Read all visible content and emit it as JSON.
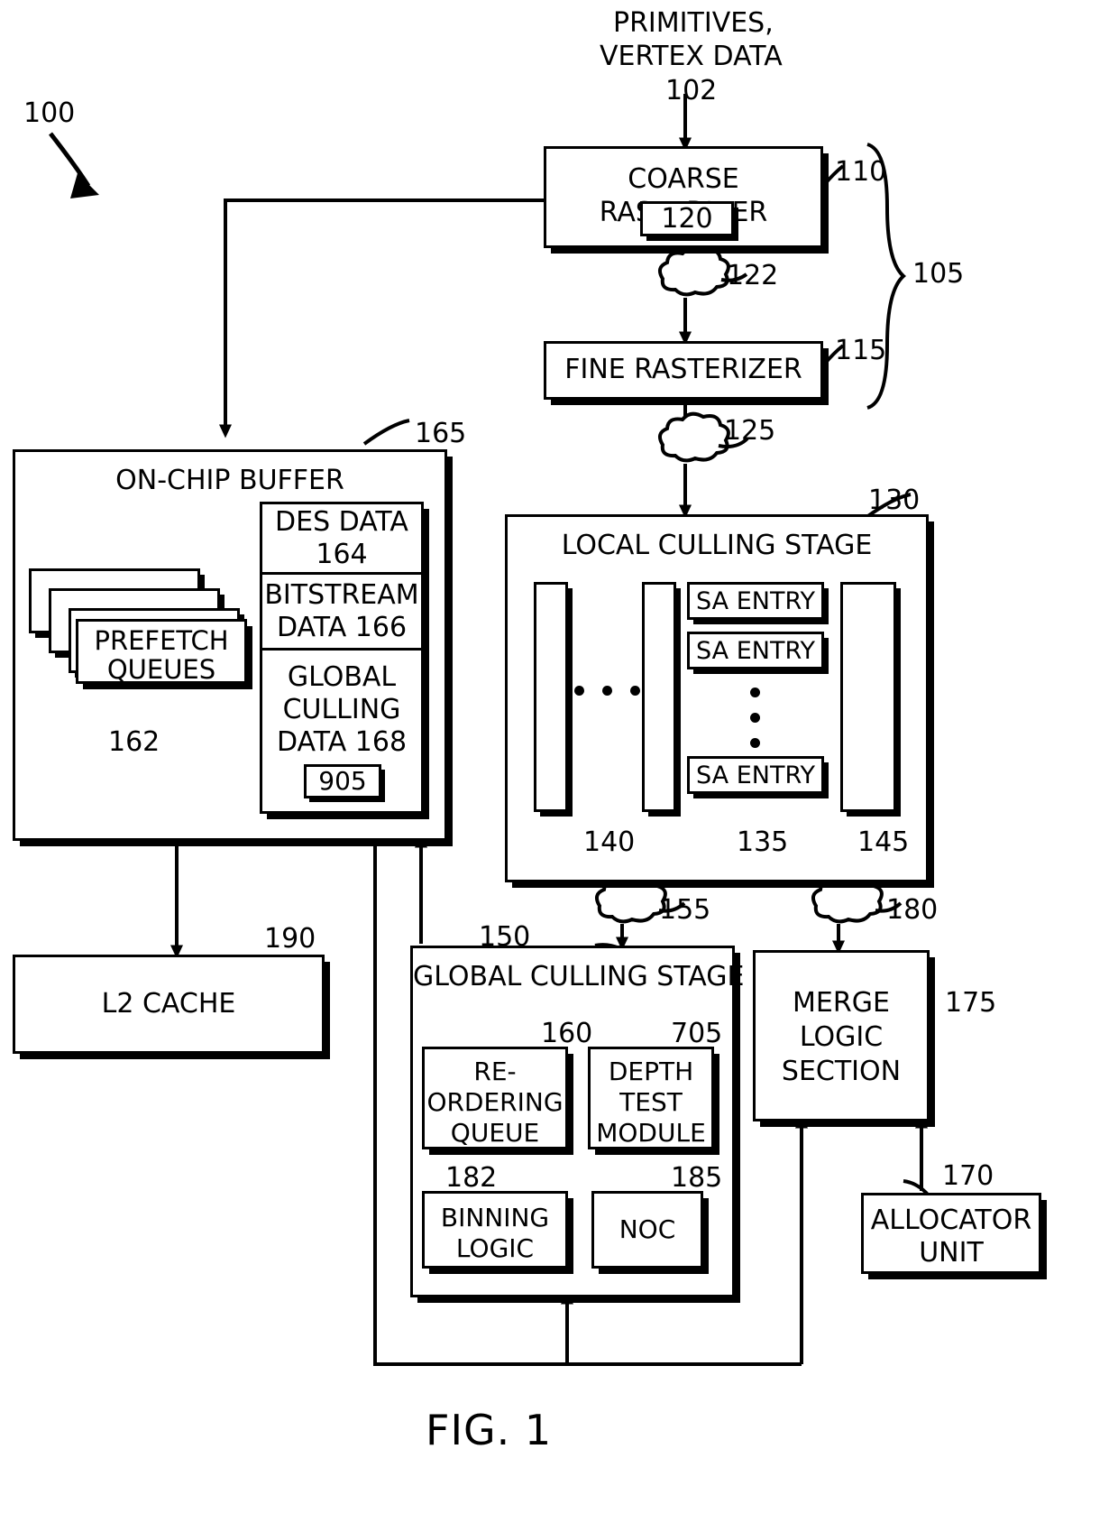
{
  "figure": {
    "caption": "FIG. 1",
    "system_ref": "100",
    "rasterizer_group_ref": "105"
  },
  "input": {
    "line1": "PRIMITIVES,",
    "line2": "VERTEX DATA",
    "ref": "102"
  },
  "coarse_rasterizer": {
    "label": "COARSE RASTERIZER",
    "ref": "110",
    "inner_ref": "120"
  },
  "cloud_122": {
    "ref": "122"
  },
  "fine_rasterizer": {
    "label": "FINE RASTERIZER",
    "ref": "115"
  },
  "cloud_125": {
    "ref": "125"
  },
  "local_culling_stage": {
    "label": "LOCAL CULLING STAGE",
    "ref": "130",
    "sa_entries": [
      "SA ENTRY",
      "SA ENTRY",
      "SA ENTRY"
    ],
    "brace_left_ref": "140",
    "brace_mid_ref": "135",
    "brace_right_ref": "145"
  },
  "cloud_155": {
    "ref": "155"
  },
  "cloud_180": {
    "ref": "180"
  },
  "on_chip_buffer": {
    "label": "ON-CHIP BUFFER",
    "ref": "165",
    "prefetch_queues": {
      "line1": "PREFETCH",
      "line2": "QUEUES",
      "brace_ref": "162"
    },
    "data_cells": [
      {
        "line1": "DES DATA",
        "line2": "164"
      },
      {
        "line1": "BITSTREAM",
        "line2": "DATA 166"
      },
      {
        "line1": "GLOBAL",
        "line2": "CULLING",
        "line3": "DATA 168"
      }
    ],
    "inner_ref": "905"
  },
  "l2_cache": {
    "label": "L2 CACHE",
    "ref": "190"
  },
  "global_culling_stage": {
    "label": "GLOBAL CULLING STAGE",
    "ref": "150",
    "reordering_queue": {
      "line1": "RE-",
      "line2": "ORDERING",
      "line3": "QUEUE",
      "ref": "160"
    },
    "depth_test_module": {
      "line1": "DEPTH",
      "line2": "TEST",
      "line3": "MODULE",
      "ref": "705"
    },
    "binning_logic": {
      "line1": "BINNING",
      "line2": "LOGIC",
      "ref": "182"
    },
    "noc": {
      "line1": "NOC",
      "ref": "185"
    }
  },
  "merge_logic_section": {
    "line1": "MERGE",
    "line2": "LOGIC",
    "line3": "SECTION",
    "ref": "175"
  },
  "allocator_unit": {
    "line1": "ALLOCATOR",
    "line2": "UNIT",
    "ref": "170"
  }
}
